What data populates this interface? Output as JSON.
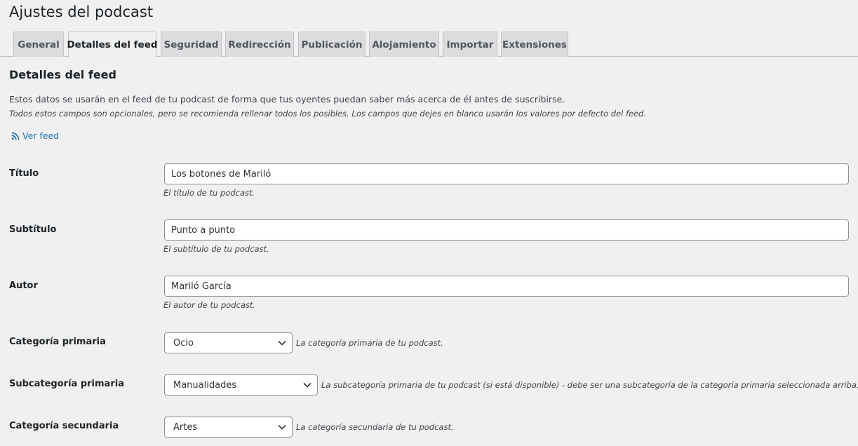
{
  "page": {
    "title": "Ajustes del podcast"
  },
  "tabs": [
    {
      "label": "General"
    },
    {
      "label": "Detalles del feed"
    },
    {
      "label": "Seguridad"
    },
    {
      "label": "Redirección"
    },
    {
      "label": "Publicación"
    },
    {
      "label": "Alojamiento"
    },
    {
      "label": "Importar"
    },
    {
      "label": "Extensiones"
    }
  ],
  "active_tab": "Detalles del feed",
  "section": {
    "title": "Detalles del feed",
    "intro": "Estos datos se usarán en el feed de tu podcast de forma que tus oyentes puedan saber más acerca de él antes de suscribirse.",
    "note": "Todos estos campos son opcionales, pero se recomienda rellenar todos los posibles. Los campos que dejes en blanco usarán los valores por defecto del feed.",
    "feed_link": "Ver feed"
  },
  "fields": {
    "title": {
      "label": "Título",
      "value": "Los botones de Mariló",
      "description": "El título de tu podcast."
    },
    "subtitle": {
      "label": "Subtítulo",
      "value": "Punto a punto",
      "description": "El subtítulo de tu podcast."
    },
    "author": {
      "label": "Autor",
      "value": "Mariló García",
      "description": "El autor de tu podcast."
    },
    "primary_category": {
      "label": "Categoría primaria",
      "selected": "Ocio",
      "description": "La categoría primaria de tu podcast."
    },
    "primary_subcategory": {
      "label": "Subcategoría primaria",
      "selected": "Manualidades",
      "description": "La subcategoría primaria de tu podcast (si está disponible) - debe ser una subcategoría de la categoría primaria seleccionada arriba."
    },
    "secondary_category": {
      "label": "Categoría secundaria",
      "selected": "Artes",
      "description": "La categoría secundaria de tu podcast."
    }
  },
  "colors": {
    "link": "#2271b1",
    "background": "#f0f0f1",
    "tab_inactive": "#dcdcde"
  },
  "icons": {
    "feed": "rss-icon",
    "dropdown": "chevron-down-icon"
  }
}
